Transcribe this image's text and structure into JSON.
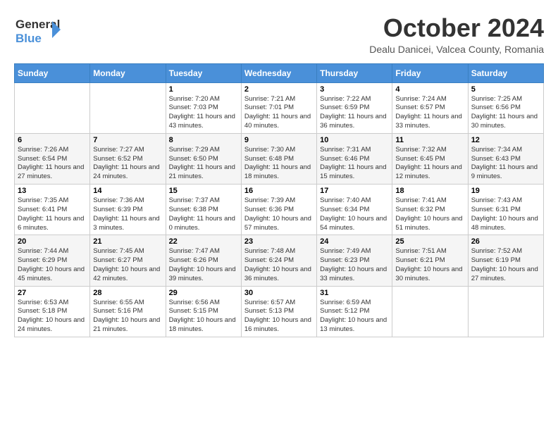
{
  "header": {
    "logo_line1": "General",
    "logo_line2": "Blue",
    "month_title": "October 2024",
    "location": "Dealu Danicei, Valcea County, Romania"
  },
  "days_of_week": [
    "Sunday",
    "Monday",
    "Tuesday",
    "Wednesday",
    "Thursday",
    "Friday",
    "Saturday"
  ],
  "weeks": [
    [
      {
        "day": "",
        "info": ""
      },
      {
        "day": "",
        "info": ""
      },
      {
        "day": "1",
        "info": "Sunrise: 7:20 AM\nSunset: 7:03 PM\nDaylight: 11 hours and 43 minutes."
      },
      {
        "day": "2",
        "info": "Sunrise: 7:21 AM\nSunset: 7:01 PM\nDaylight: 11 hours and 40 minutes."
      },
      {
        "day": "3",
        "info": "Sunrise: 7:22 AM\nSunset: 6:59 PM\nDaylight: 11 hours and 36 minutes."
      },
      {
        "day": "4",
        "info": "Sunrise: 7:24 AM\nSunset: 6:57 PM\nDaylight: 11 hours and 33 minutes."
      },
      {
        "day": "5",
        "info": "Sunrise: 7:25 AM\nSunset: 6:56 PM\nDaylight: 11 hours and 30 minutes."
      }
    ],
    [
      {
        "day": "6",
        "info": "Sunrise: 7:26 AM\nSunset: 6:54 PM\nDaylight: 11 hours and 27 minutes."
      },
      {
        "day": "7",
        "info": "Sunrise: 7:27 AM\nSunset: 6:52 PM\nDaylight: 11 hours and 24 minutes."
      },
      {
        "day": "8",
        "info": "Sunrise: 7:29 AM\nSunset: 6:50 PM\nDaylight: 11 hours and 21 minutes."
      },
      {
        "day": "9",
        "info": "Sunrise: 7:30 AM\nSunset: 6:48 PM\nDaylight: 11 hours and 18 minutes."
      },
      {
        "day": "10",
        "info": "Sunrise: 7:31 AM\nSunset: 6:46 PM\nDaylight: 11 hours and 15 minutes."
      },
      {
        "day": "11",
        "info": "Sunrise: 7:32 AM\nSunset: 6:45 PM\nDaylight: 11 hours and 12 minutes."
      },
      {
        "day": "12",
        "info": "Sunrise: 7:34 AM\nSunset: 6:43 PM\nDaylight: 11 hours and 9 minutes."
      }
    ],
    [
      {
        "day": "13",
        "info": "Sunrise: 7:35 AM\nSunset: 6:41 PM\nDaylight: 11 hours and 6 minutes."
      },
      {
        "day": "14",
        "info": "Sunrise: 7:36 AM\nSunset: 6:39 PM\nDaylight: 11 hours and 3 minutes."
      },
      {
        "day": "15",
        "info": "Sunrise: 7:37 AM\nSunset: 6:38 PM\nDaylight: 11 hours and 0 minutes."
      },
      {
        "day": "16",
        "info": "Sunrise: 7:39 AM\nSunset: 6:36 PM\nDaylight: 10 hours and 57 minutes."
      },
      {
        "day": "17",
        "info": "Sunrise: 7:40 AM\nSunset: 6:34 PM\nDaylight: 10 hours and 54 minutes."
      },
      {
        "day": "18",
        "info": "Sunrise: 7:41 AM\nSunset: 6:32 PM\nDaylight: 10 hours and 51 minutes."
      },
      {
        "day": "19",
        "info": "Sunrise: 7:43 AM\nSunset: 6:31 PM\nDaylight: 10 hours and 48 minutes."
      }
    ],
    [
      {
        "day": "20",
        "info": "Sunrise: 7:44 AM\nSunset: 6:29 PM\nDaylight: 10 hours and 45 minutes."
      },
      {
        "day": "21",
        "info": "Sunrise: 7:45 AM\nSunset: 6:27 PM\nDaylight: 10 hours and 42 minutes."
      },
      {
        "day": "22",
        "info": "Sunrise: 7:47 AM\nSunset: 6:26 PM\nDaylight: 10 hours and 39 minutes."
      },
      {
        "day": "23",
        "info": "Sunrise: 7:48 AM\nSunset: 6:24 PM\nDaylight: 10 hours and 36 minutes."
      },
      {
        "day": "24",
        "info": "Sunrise: 7:49 AM\nSunset: 6:23 PM\nDaylight: 10 hours and 33 minutes."
      },
      {
        "day": "25",
        "info": "Sunrise: 7:51 AM\nSunset: 6:21 PM\nDaylight: 10 hours and 30 minutes."
      },
      {
        "day": "26",
        "info": "Sunrise: 7:52 AM\nSunset: 6:19 PM\nDaylight: 10 hours and 27 minutes."
      }
    ],
    [
      {
        "day": "27",
        "info": "Sunrise: 6:53 AM\nSunset: 5:18 PM\nDaylight: 10 hours and 24 minutes."
      },
      {
        "day": "28",
        "info": "Sunrise: 6:55 AM\nSunset: 5:16 PM\nDaylight: 10 hours and 21 minutes."
      },
      {
        "day": "29",
        "info": "Sunrise: 6:56 AM\nSunset: 5:15 PM\nDaylight: 10 hours and 18 minutes."
      },
      {
        "day": "30",
        "info": "Sunrise: 6:57 AM\nSunset: 5:13 PM\nDaylight: 10 hours and 16 minutes."
      },
      {
        "day": "31",
        "info": "Sunrise: 6:59 AM\nSunset: 5:12 PM\nDaylight: 10 hours and 13 minutes."
      },
      {
        "day": "",
        "info": ""
      },
      {
        "day": "",
        "info": ""
      }
    ]
  ]
}
